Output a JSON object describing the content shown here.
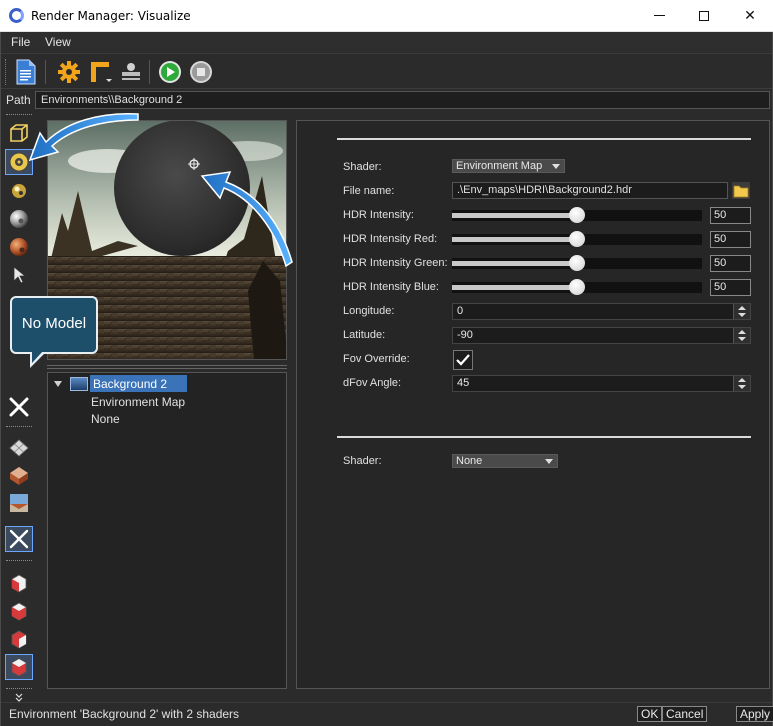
{
  "window": {
    "title": "Render Manager: Visualize",
    "controls": {
      "minimize": "—",
      "maximize": "☐",
      "close": "✕"
    }
  },
  "menu": {
    "items": [
      "File",
      "View"
    ]
  },
  "toolbar": {
    "buttons": [
      "new-document-icon",
      "settings-gear-icon",
      "frame-icon",
      "render-stamp-icon",
      "play-icon",
      "stop-icon"
    ],
    "colors": {
      "gear": "#f2a51a",
      "play": "#2eaa3a",
      "doc": "#3a7fd5"
    }
  },
  "path": {
    "label": "Path",
    "value": "Environments\\\\Background 2"
  },
  "left_toolbar": {
    "buttons": [
      "cube-outline-icon",
      "environment-sphere-icon",
      "material-ball-icon",
      "chrome-ball-icon",
      "textured-ball-icon",
      "pointer-icon",
      "none-x-icon",
      "grid-plane-icon",
      "floor-tile-icon",
      "backdrop-icon",
      "none-x-icon",
      "red-cube-icon",
      "red-cube-icon",
      "red-cube-icon",
      "red-cube-icon",
      "expand-chevron-icon"
    ]
  },
  "tree": {
    "root": "Background 2",
    "children": [
      "Environment Map",
      "None"
    ]
  },
  "properties": {
    "shader_label": "Shader:",
    "shader_value": "Environment Map",
    "file_label": "File name:",
    "file_value": ".\\Env_maps\\HDRI\\Background2.hdr",
    "sliders": [
      {
        "label": "HDR Intensity:",
        "value": "50",
        "fraction": 0.5
      },
      {
        "label": "HDR Intensity Red:",
        "value": "50",
        "fraction": 0.5
      },
      {
        "label": "HDR Intensity Green:",
        "value": "50",
        "fraction": 0.5
      },
      {
        "label": "HDR Intensity Blue:",
        "value": "50",
        "fraction": 0.5
      }
    ],
    "longitude_label": "Longitude:",
    "longitude_value": "0",
    "latitude_label": "Latitude:",
    "latitude_value": "-90",
    "fov_override_label": "Fov Override:",
    "fov_override_checked": true,
    "dfov_label": "dFov Angle:",
    "dfov_value": "45",
    "shader2_label": "Shader:",
    "shader2_value": "None"
  },
  "status": {
    "text": "Environment 'Background 2' with 2 shaders",
    "ok": "OK",
    "cancel": "Cancel",
    "apply": "Apply"
  },
  "annotations": {
    "tooltip": "No Model",
    "arrow_color": "#2f8fe0"
  }
}
